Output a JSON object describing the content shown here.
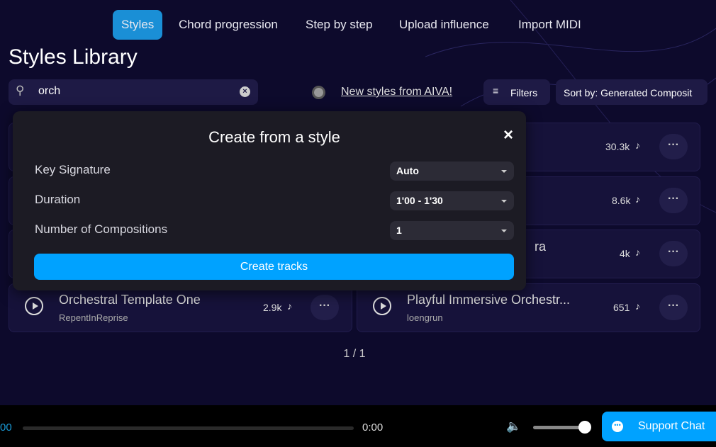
{
  "tabs": [
    {
      "label": "Styles",
      "active": true
    },
    {
      "label": "Chord progression"
    },
    {
      "label": "Step by step"
    },
    {
      "label": "Upload influence"
    },
    {
      "label": "Import MIDI"
    }
  ],
  "page_title": "Styles Library",
  "search": {
    "value": "orch"
  },
  "new_styles_link": "New styles from AIVA!",
  "filters_label": "Filters",
  "sort_label": "Sort by: Generated Composit",
  "cards": [
    {
      "count": "30.3k"
    },
    {
      "count": "8.6k"
    },
    {
      "title_fragment": "ra",
      "count": "4k"
    },
    {
      "title": "Orchestral Template One",
      "author": "RepentInReprise",
      "count": "2.9k"
    },
    {
      "title": "Playful Immersive Orchestr...",
      "author": "loengrun",
      "count": "651"
    }
  ],
  "pagination": "1 / 1",
  "modal": {
    "title": "Create from a style",
    "fields": [
      {
        "label": "Key Signature",
        "value": "Auto"
      },
      {
        "label": "Duration",
        "value": "1'00 - 1'30"
      },
      {
        "label": "Number of Compositions",
        "value": "1"
      }
    ],
    "submit": "Create tracks"
  },
  "player": {
    "elapsed": "00",
    "total": "0:00",
    "volume": 1
  },
  "support_chat": "Support Chat",
  "colors": {
    "accent": "#00a2ff",
    "background": "#0d0a2c",
    "modal": "#1c1b24"
  }
}
